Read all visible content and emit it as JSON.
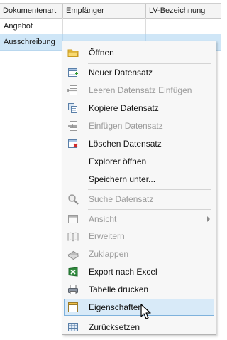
{
  "grid": {
    "columns": [
      "Dokumentenart",
      "Empfänger",
      "LV-Bezeichnung"
    ],
    "rows": [
      {
        "dokumentenart": "Angebot"
      },
      {
        "dokumentenart": "Ausschreibung"
      }
    ]
  },
  "context_menu": {
    "items": [
      {
        "label": "Öffnen",
        "icon": "folder-icon",
        "enabled": true
      },
      {
        "label": "Neuer Datensatz",
        "icon": "new-record-icon",
        "enabled": true
      },
      {
        "label": "Leeren Datensatz Einfügen",
        "icon": "insert-empty-record-icon",
        "enabled": false
      },
      {
        "label": "Kopiere Datensatz",
        "icon": "copy-record-icon",
        "enabled": true
      },
      {
        "label": "Einfügen Datensatz",
        "icon": "paste-record-icon",
        "enabled": false
      },
      {
        "label": "Löschen Datensatz",
        "icon": "delete-record-icon",
        "enabled": true
      },
      {
        "label": "Explorer öffnen",
        "icon": "",
        "enabled": true
      },
      {
        "label": "Speichern unter...",
        "icon": "",
        "enabled": true
      },
      {
        "label": "Suche Datensatz",
        "icon": "search-icon",
        "enabled": false
      },
      {
        "label": "Ansicht",
        "icon": "view-icon",
        "enabled": false,
        "submenu": true
      },
      {
        "label": "Erweitern",
        "icon": "book-open-icon",
        "enabled": false
      },
      {
        "label": "Zuklappen",
        "icon": "book-closed-icon",
        "enabled": false
      },
      {
        "label": "Export nach Excel",
        "icon": "excel-icon",
        "enabled": true
      },
      {
        "label": "Tabelle drucken",
        "icon": "printer-icon",
        "enabled": true
      },
      {
        "label": "Eigenschaften",
        "icon": "properties-icon",
        "enabled": true,
        "hovered": true
      },
      {
        "label": "Zurücksetzen",
        "icon": "reset-icon",
        "enabled": true
      }
    ]
  },
  "colors": {
    "selection_row": "#cfe6f7",
    "menu_hover": "#d8eaf8",
    "menu_hover_border": "#7fb2dc",
    "disabled_text": "#9a9a9a"
  }
}
